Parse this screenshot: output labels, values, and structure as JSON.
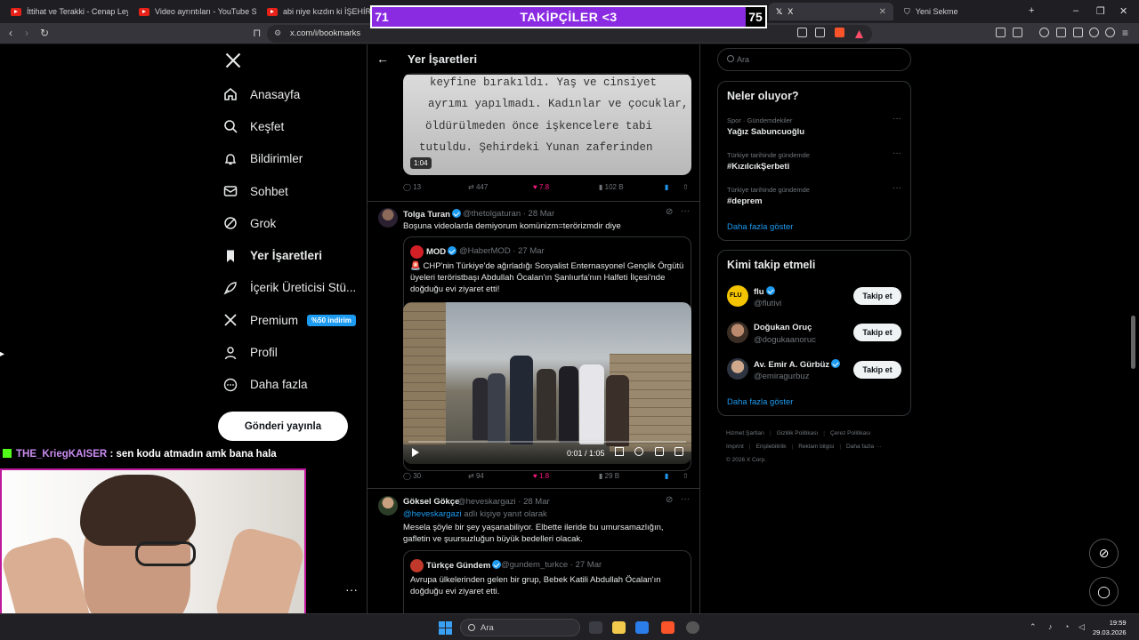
{
  "browser": {
    "tabs": [
      {
        "label": "İttihat ve Terakki - Cenap Leyla",
        "type": "youtube"
      },
      {
        "label": "Video ayrıntıları - YouTube Studio",
        "type": "youtube"
      },
      {
        "label": "abi niye kızdın ki İŞEHİR BULMA",
        "type": "youtube"
      },
      {
        "label": "X",
        "type": "x"
      },
      {
        "label": "Yeni Sekme",
        "type": "new"
      }
    ],
    "url": "x.com/i/bookmarks"
  },
  "overlay_banner": {
    "left_count": "71",
    "title": "TAKİPÇİLER <3",
    "right_count": "75"
  },
  "sidebar": {
    "items": [
      {
        "label": "Anasayfa",
        "icon": "home-icon"
      },
      {
        "label": "Keşfet",
        "icon": "search-icon"
      },
      {
        "label": "Bildirimler",
        "icon": "bell-icon"
      },
      {
        "label": "Sohbet",
        "icon": "mail-icon"
      },
      {
        "label": "Grok",
        "icon": "grok-icon"
      },
      {
        "label": "Yer İşaretleri",
        "icon": "bookmark-icon"
      },
      {
        "label": "İçerik Üreticisi Stü...",
        "icon": "rocket-icon"
      },
      {
        "label": "Premium",
        "icon": "x-icon"
      },
      {
        "label": "Profil",
        "icon": "person-icon"
      },
      {
        "label": "Daha fazla",
        "icon": "more-circle-icon"
      }
    ],
    "premium_badge": "%50 indirim",
    "post_button": "Gönderi yayınla"
  },
  "feed": {
    "title": "Yer İşaretleri",
    "tweet0": {
      "video_lines": [
        "keyfine bırakıldı. Yaş ve cinsiyet",
        "ayrımı yapılmadı. Kadınlar ve çocuklar,",
        "öldürülmeden önce işkencelere tabi",
        "tutuldu. Şehirdeki Yunan zaferinden"
      ],
      "duration": "1:04",
      "replies": "13",
      "reposts": "447",
      "likes": "7.8",
      "views": "102 B"
    },
    "tweet1": {
      "name": "Tolga Turan",
      "handle": "@thetolgaturan",
      "date": "· 28 Mar",
      "text": "Boşuna videolarda demiyorum komünizm=terörizmdir diye",
      "quote": {
        "name": "MOD",
        "handle": "@HaberMOD",
        "date": "· 27 Mar",
        "text": "🚨 CHP'nin Türkiye'de ağırladığı Sosyalist Enternasyonel Gençlik Örgütü üyeleri teröristbaşı Abdullah Öcalan'ın Şanlıurfa'nın Halfeti İlçesi'nde doğduğu evi ziyaret etti!",
        "video_time": "0:01 / 1:05"
      },
      "replies": "30",
      "reposts": "94",
      "likes": "1.8",
      "views": "29 B"
    },
    "tweet2": {
      "name": "Göksel Gökçe",
      "handle": "@heveskargazi",
      "date": "· 28 Mar",
      "reply_to_handle": "@heveskargazi",
      "reply_to_suffix": " adlı kişiye yanıt olarak",
      "text": "Mesela şöyle bir şey yaşanabiliyor. Elbette ileride bu umursamazlığın, gafletin ve şuursuzluğun büyük bedelleri olacak.",
      "quote": {
        "name": "Türkçe Gündem",
        "handle": "@gundem_turkce",
        "date": "· 27 Mar",
        "text": "Avrupa ülkelerinden gelen bir grup, Bebek Katili Abdullah Öcalan'ın doğduğu evi ziyaret etti."
      }
    }
  },
  "right": {
    "search_placeholder": "Ara",
    "trends": {
      "title": "Neler oluyor?",
      "items": [
        {
          "category": "Spor · Gündemdekiler",
          "name": "Yağız Sabuncuoğlu"
        },
        {
          "category": "Türkiye tarihinde gündemde",
          "name": "#KızılcıkŞerbeti"
        },
        {
          "category": "Türkiye tarihinde gündemde",
          "name": "#deprem"
        }
      ],
      "show_more": "Daha fazla göster"
    },
    "who_to_follow": {
      "title": "Kimi takip etmeli",
      "items": [
        {
          "name": "flu",
          "handle": "@flutivi"
        },
        {
          "name": "Doğukan Oruç",
          "handle": "@dogukaanoruc"
        },
        {
          "name": "Av. Emir A. Gürbüz",
          "handle": "@emiragurbuz"
        }
      ],
      "follow_label": "Takip et",
      "show_more": "Daha fazla göster"
    },
    "footer": {
      "links1": [
        "Hizmet Şartları",
        "Gizlilik Politikası",
        "Çerez Politikası"
      ],
      "links2": [
        "Imprint",
        "Erişilebilirlik",
        "Reklam bilgisi",
        "Daha fazla ···"
      ],
      "copyright": "© 2026 X Corp."
    }
  },
  "stream": {
    "chat_user": "THE_KriegKAISER",
    "chat_message": " : sen kodu atmadın amk bana hala"
  },
  "taskbar": {
    "search_placeholder": "Ara",
    "time": "19:59",
    "date": "29.03.2026"
  }
}
